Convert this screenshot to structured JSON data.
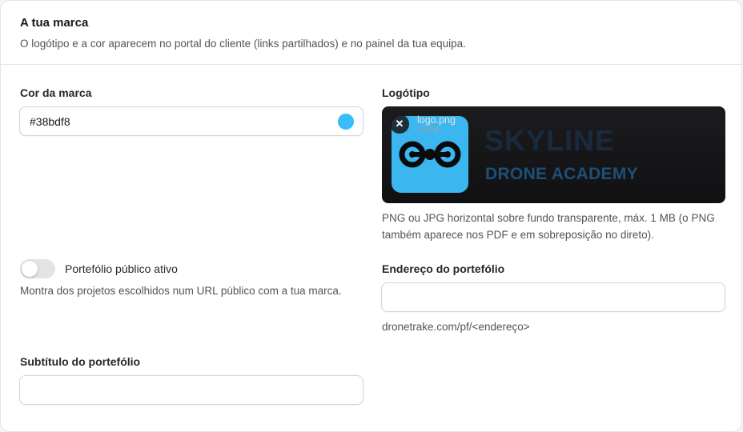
{
  "header": {
    "title": "A tua marca",
    "subtitle": "O logótipo e a cor aparecem no portal do cliente (links partilhados) e no painel da tua equipa."
  },
  "brand_color": {
    "label": "Cor da marca",
    "value": "#38bdf8",
    "swatch_color": "#38bdf8"
  },
  "logo": {
    "label": "Logótipo",
    "file_name": "logo.png",
    "file_size": "13 KB",
    "remove_icon": "close-icon",
    "image_text_line1": "SKYLINE",
    "image_text_line2": "DRONE ACADEMY",
    "help": "PNG ou JPG horizontal sobre fundo transparente, máx. 1 MB (o PNG também aparece nos PDF e em sobreposição no direto)."
  },
  "portfolio_toggle": {
    "label": "Portefólio público ativo",
    "enabled": false,
    "help": "Montra dos projetos escolhidos num URL público com a tua marca."
  },
  "portfolio_address": {
    "label": "Endereço do portefólio",
    "value": "",
    "help": "dronetrake.com/pf/<endereço>"
  },
  "portfolio_subtitle": {
    "label": "Subtítulo do portefólio",
    "value": ""
  }
}
